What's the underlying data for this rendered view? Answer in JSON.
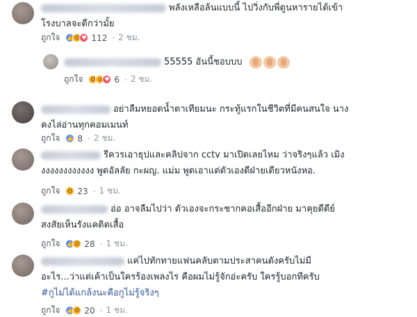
{
  "colors": {
    "text": "#1d2129",
    "meta": "#90949c",
    "link": "#365899",
    "like_blue": "#5890ff",
    "haha_yellow": "#f7b125",
    "love_red": "#f25268"
  },
  "comments": [
    {
      "lines": [
        "พลังเหลือล้นแบบนี้ ไปวิ่งกับพี่ตูนหารายได้เข้า",
        "โรงบาลจะดีกว่ามั้ย"
      ],
      "like_label": "ถูกใจ",
      "reactions": [
        "like-icon",
        "haha-icon",
        "love-icon"
      ],
      "count": "112",
      "time": "2 ชม."
    },
    {
      "lines": [
        "55555 อันนี้ชอบบบ"
      ],
      "like_label": "ถูกใจ",
      "reactions": [
        "like-icon",
        "haha-icon",
        "love-icon"
      ],
      "count": "6",
      "time": "2 ชม.",
      "icons": [
        "clap-icon",
        "clap-icon",
        "clap-icon"
      ]
    },
    {
      "lines": [
        "อย่าลืมหยอดน้ำตาเทียมนะ กระทู้แรกในชีวิตที่มีคนสนใจ นาง",
        "คงไล่อ่านทุกคอมเมนท์"
      ],
      "like_label": "ถูกใจ",
      "reactions": [
        "like-icon"
      ],
      "count": "8",
      "time": "2 ชม."
    },
    {
      "lines": [
        "รีควรเอาธุปและคลิปจาก cctv มาเปิดเลยไหม ว่าจริงๆแล้ว เมิง",
        "งงงงงงงงงงงง พูดอัลลัย กะผญ. แม่ม พูดเอาแต่ตัวเองดีฝ่ายเดียวหนังหอ."
      ],
      "like_label": "ถูกใจ",
      "reactions": [
        "haha-icon"
      ],
      "count": "23",
      "time": "1 ชม."
    },
    {
      "lines": [
        "อ่อ อาจลืมไปว่า ตัวเองจะกระชากคอเสื้ออีกฝ่าย มาคุยดีดีย์",
        "สงสัยเห็นรังแคติดเสื้อ"
      ],
      "like_label": "ถูกใจ",
      "reactions": [
        "like-icon",
        "haha-icon"
      ],
      "count": "28",
      "time": "1 ชม."
    },
    {
      "lines": [
        "แค่ไปทักทายแฟนคลับตามประสาคนดังครับไม่มี",
        "อะไร...ว่าแต่เค้าเป็นใครร้องเพลงไร คือผมไม่รู้จักอ่ะครับ ใครรู้บอกทีครับ",
        "#กูไม่ได้แกล้งนะคือกูไม่รู้จริงๆ"
      ],
      "like_label": "ถูกใจ",
      "reactions": [
        "like-icon",
        "haha-icon"
      ],
      "count": "20",
      "time": "1 ชม."
    }
  ]
}
